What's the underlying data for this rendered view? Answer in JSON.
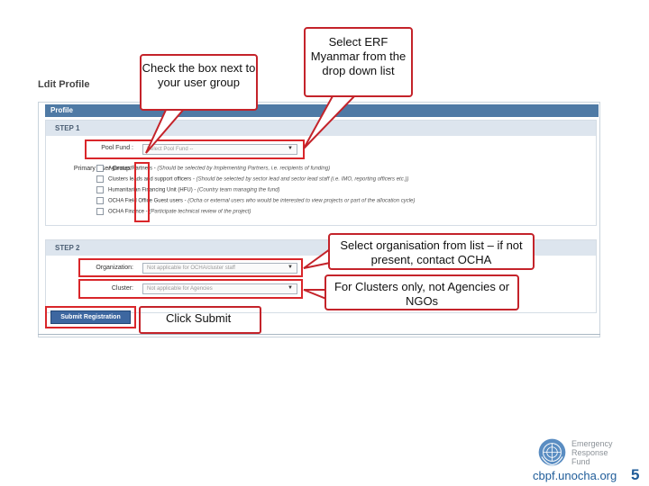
{
  "page": {
    "title": "Ldit Profile",
    "profile_bar": "Profile",
    "step1_label": "STEP 1",
    "step2_label": "STEP 2"
  },
  "step1": {
    "pool_fund_label": "Pool Fund :",
    "pool_fund_value": "Select Pool Fund --",
    "primary_user_group_label": "Primary User Group:",
    "user_groups": [
      {
        "name": "Agencies/Partners -",
        "description": "(Should be selected by Implementing Partners, i.e. recipients of funding)"
      },
      {
        "name": "Clusters leads and support officers -",
        "description": "(Should be selected by sector lead and sector lead staff (i.e. IMO, reporting officers etc.))"
      },
      {
        "name": "Humanitarian Financing Unit (HFU) -",
        "description": "(Country team managing the fund)"
      },
      {
        "name": "OCHA Field Office Guest users -",
        "description": "(Ocha or external users who would be interested to view projects or part of the allocation cycle)"
      },
      {
        "name": "OCHA Finance -",
        "description": "(Participate technical review of the project)"
      }
    ]
  },
  "step2": {
    "organization_label": "Organization:",
    "organization_value": "Not applicable for OCHA/cluster staff",
    "cluster_label": "Cluster:",
    "cluster_value": "Not applicable for Agencies"
  },
  "submit_label": "Submit Registration",
  "callouts": {
    "check_box": "Check the box next to your user group",
    "select_erf": "Select ERF Myanmar from the drop down list",
    "select_org": "Select organisation from list – if not present, contact OCHA",
    "clusters_only": "For Clusters only, not Agencies or NGOs",
    "click_submit": "Click Submit"
  },
  "footer": {
    "logo_text_line1": "Emergency",
    "logo_text_line2": "Response",
    "logo_text_line3": "Fund",
    "site": "cbpf.unocha.org",
    "page_number": "5"
  },
  "colors": {
    "accent": "#4f7aa5",
    "highlight": "#d9262a",
    "link": "#1f5c99"
  }
}
